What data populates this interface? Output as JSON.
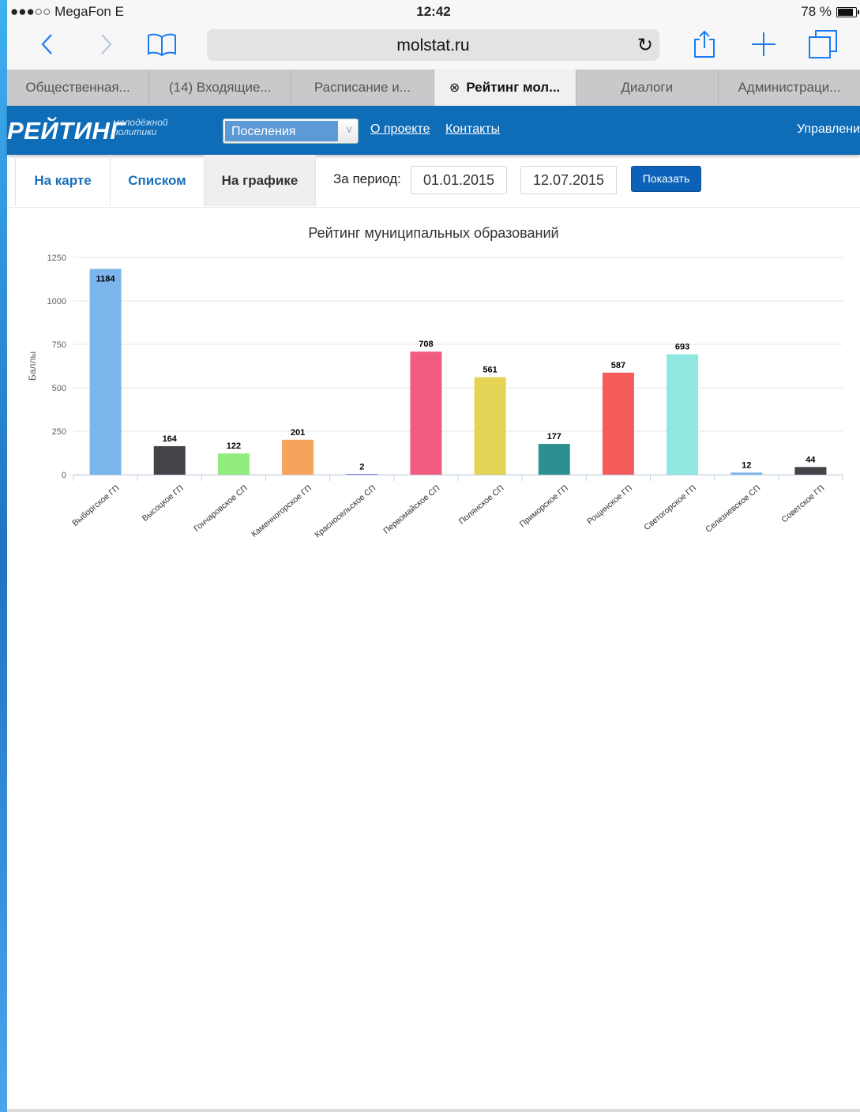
{
  "status_bar": {
    "carrier": "●●●○○ MegaFon  E",
    "time": "12:42",
    "battery": "78 %"
  },
  "browser": {
    "url": "molstat.ru",
    "tabs": [
      {
        "label": "Общественная..."
      },
      {
        "label": "(14) Входящие..."
      },
      {
        "label": "Расписание и..."
      },
      {
        "label": "Рейтинг мол..."
      },
      {
        "label": "Диалоги"
      },
      {
        "label": "Администраци..."
      }
    ]
  },
  "site": {
    "logo": "РЕЙТИНГ",
    "logo_sub_1": "молодёжной",
    "logo_sub_2": "политики",
    "select_value": "Поселения",
    "nav_about": "О проекте",
    "nav_contacts": "Контакты",
    "nav_right": "Управлени"
  },
  "view": {
    "tab_map": "На карте",
    "tab_list": "Списком",
    "tab_chart": "На графике",
    "period_label": "За период:",
    "date_from": "01.01.2015",
    "date_to": "12.07.2015",
    "show_button": "Показать"
  },
  "chart_data": {
    "type": "bar",
    "title": "Рейтинг муниципальных образований",
    "ylabel": "Баллы",
    "xlabel": "",
    "ylim": [
      0,
      1250
    ],
    "yticks": [
      0,
      250,
      500,
      750,
      1000,
      1250
    ],
    "grid": true,
    "categories": [
      "Выборгское ГП",
      "Высоцкое ГП",
      "Гончаровское СП",
      "Каменногорское ГП",
      "Красносельское СП",
      "Первомайское СП",
      "Полянское СП",
      "Приморское ГП",
      "Рощинское ГП",
      "Светогорское ГП",
      "Селезневское СП",
      "Советское ГП"
    ],
    "values": [
      1184,
      164,
      122,
      201,
      2,
      708,
      561,
      177,
      587,
      693,
      12,
      44
    ],
    "colors": [
      "#7cb5ec",
      "#434348",
      "#90ed7d",
      "#f7a35c",
      "#8085e9",
      "#f15c80",
      "#e4d354",
      "#2b908f",
      "#f45b5b",
      "#91e8e1",
      "#7cb5ec",
      "#434348"
    ]
  }
}
